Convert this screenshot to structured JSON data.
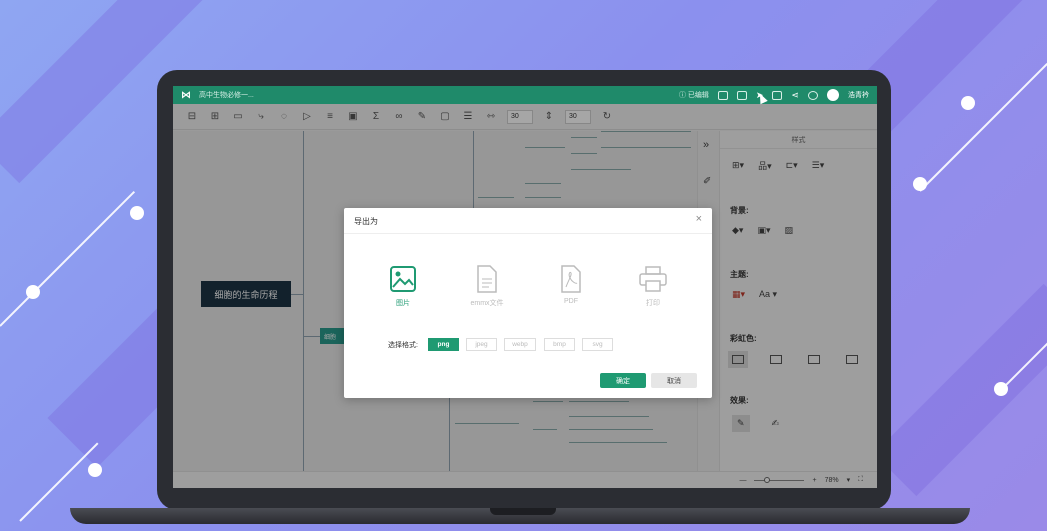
{
  "app": {
    "doc_title": "高中生物必修一...",
    "status": "已编辑",
    "user_name": "浩青衿"
  },
  "toolbar": {
    "spacing_h": "30",
    "spacing_v": "30"
  },
  "mindmap": {
    "root": "细胞的生命历程",
    "child_stub": "细胞"
  },
  "panel": {
    "title": "样式",
    "background_label": "背景:",
    "theme_label": "主题:",
    "font_label": "Aa",
    "rainbow_label": "彩虹色:",
    "effect_label": "效果:"
  },
  "statusbar": {
    "zoom": "78%"
  },
  "dialog": {
    "title": "导出为",
    "options": [
      {
        "label": "图片",
        "icon": "image-icon",
        "active": true
      },
      {
        "label": "emmx文件",
        "icon": "file-icon",
        "active": false
      },
      {
        "label": "PDF",
        "icon": "pdf-icon",
        "active": false
      },
      {
        "label": "打印",
        "icon": "printer-icon",
        "active": false
      }
    ],
    "choose_format_label": "选择格式:",
    "formats": [
      "png",
      "jpeg",
      "webp",
      "bmp",
      "svg"
    ],
    "selected_format": "png",
    "ok_label": "确定",
    "cancel_label": "取消"
  },
  "colors": {
    "accent": "#1f9a72",
    "titlebar": "#1f8a6a",
    "root_node": "#1d3344"
  }
}
